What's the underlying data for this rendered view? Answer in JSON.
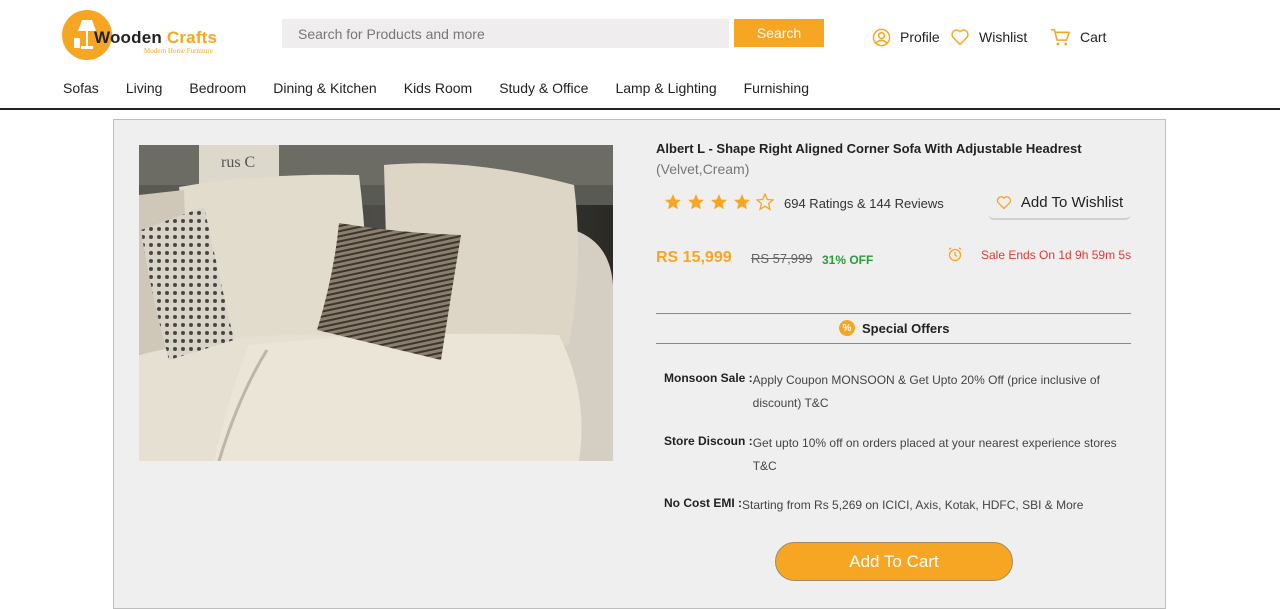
{
  "brand": {
    "name_part1": "Wooden",
    "name_part2": "Crafts",
    "tagline": "Modern Home Furniture"
  },
  "search": {
    "placeholder": "Search for Products and more",
    "button_label": "Search"
  },
  "header_links": {
    "profile": "Profile",
    "wishlist": "Wishlist",
    "cart": "Cart"
  },
  "nav": [
    "Sofas",
    "Living",
    "Bedroom",
    "Dining & Kitchen",
    "Kids Room",
    "Study & Office",
    "Lamp & Lighting",
    "Furnishing"
  ],
  "product": {
    "title": "Albert L - Shape Right Aligned Corner Sofa With Adjustable Headrest",
    "variant": "(Velvet,Cream)",
    "rating_stars": 4,
    "rating_max": 5,
    "ratings_text": "694 Ratings & 144 Reviews",
    "wishlist_label": "Add To Wishlist",
    "price": "RS 15,999",
    "mrp": "RS 57,999",
    "discount": "31% OFF",
    "sale_ends": "Sale Ends On 1d 9h 59m 5s",
    "photo_sign_text": "rus C"
  },
  "offers": {
    "heading": "Special Offers",
    "badge": "%",
    "items": [
      {
        "label": "Monsoon Sale :",
        "text": "Apply Coupon MONSOON & Get Upto 20% Off (price inclusive of discount) T&C"
      },
      {
        "label": "Store Discoun :",
        "text": "Get upto 10% off on orders placed at your nearest experience stores T&C"
      },
      {
        "label": "No Cost EMI :",
        "text": "Starting from Rs 5,269 on ICICI, Axis, Kotak, HDFC, SBI & More"
      }
    ]
  },
  "cta": {
    "add_to_cart": "Add To Cart"
  },
  "colors": {
    "accent": "#f6a623",
    "discount": "#2e9a3a",
    "sale": "#e53935",
    "panel_bg": "#efefef"
  }
}
